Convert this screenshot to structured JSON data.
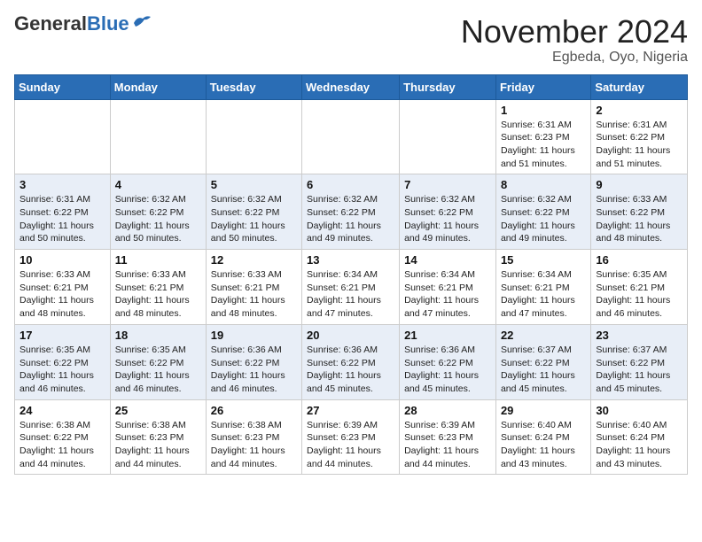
{
  "header": {
    "logo_general": "General",
    "logo_blue": "Blue",
    "month_title": "November 2024",
    "location": "Egbeda, Oyo, Nigeria"
  },
  "weekdays": [
    "Sunday",
    "Monday",
    "Tuesday",
    "Wednesday",
    "Thursday",
    "Friday",
    "Saturday"
  ],
  "weeks": [
    [
      {
        "day": "",
        "info": ""
      },
      {
        "day": "",
        "info": ""
      },
      {
        "day": "",
        "info": ""
      },
      {
        "day": "",
        "info": ""
      },
      {
        "day": "",
        "info": ""
      },
      {
        "day": "1",
        "info": "Sunrise: 6:31 AM\nSunset: 6:23 PM\nDaylight: 11 hours\nand 51 minutes."
      },
      {
        "day": "2",
        "info": "Sunrise: 6:31 AM\nSunset: 6:22 PM\nDaylight: 11 hours\nand 51 minutes."
      }
    ],
    [
      {
        "day": "3",
        "info": "Sunrise: 6:31 AM\nSunset: 6:22 PM\nDaylight: 11 hours\nand 50 minutes."
      },
      {
        "day": "4",
        "info": "Sunrise: 6:32 AM\nSunset: 6:22 PM\nDaylight: 11 hours\nand 50 minutes."
      },
      {
        "day": "5",
        "info": "Sunrise: 6:32 AM\nSunset: 6:22 PM\nDaylight: 11 hours\nand 50 minutes."
      },
      {
        "day": "6",
        "info": "Sunrise: 6:32 AM\nSunset: 6:22 PM\nDaylight: 11 hours\nand 49 minutes."
      },
      {
        "day": "7",
        "info": "Sunrise: 6:32 AM\nSunset: 6:22 PM\nDaylight: 11 hours\nand 49 minutes."
      },
      {
        "day": "8",
        "info": "Sunrise: 6:32 AM\nSunset: 6:22 PM\nDaylight: 11 hours\nand 49 minutes."
      },
      {
        "day": "9",
        "info": "Sunrise: 6:33 AM\nSunset: 6:22 PM\nDaylight: 11 hours\nand 48 minutes."
      }
    ],
    [
      {
        "day": "10",
        "info": "Sunrise: 6:33 AM\nSunset: 6:21 PM\nDaylight: 11 hours\nand 48 minutes."
      },
      {
        "day": "11",
        "info": "Sunrise: 6:33 AM\nSunset: 6:21 PM\nDaylight: 11 hours\nand 48 minutes."
      },
      {
        "day": "12",
        "info": "Sunrise: 6:33 AM\nSunset: 6:21 PM\nDaylight: 11 hours\nand 48 minutes."
      },
      {
        "day": "13",
        "info": "Sunrise: 6:34 AM\nSunset: 6:21 PM\nDaylight: 11 hours\nand 47 minutes."
      },
      {
        "day": "14",
        "info": "Sunrise: 6:34 AM\nSunset: 6:21 PM\nDaylight: 11 hours\nand 47 minutes."
      },
      {
        "day": "15",
        "info": "Sunrise: 6:34 AM\nSunset: 6:21 PM\nDaylight: 11 hours\nand 47 minutes."
      },
      {
        "day": "16",
        "info": "Sunrise: 6:35 AM\nSunset: 6:21 PM\nDaylight: 11 hours\nand 46 minutes."
      }
    ],
    [
      {
        "day": "17",
        "info": "Sunrise: 6:35 AM\nSunset: 6:22 PM\nDaylight: 11 hours\nand 46 minutes."
      },
      {
        "day": "18",
        "info": "Sunrise: 6:35 AM\nSunset: 6:22 PM\nDaylight: 11 hours\nand 46 minutes."
      },
      {
        "day": "19",
        "info": "Sunrise: 6:36 AM\nSunset: 6:22 PM\nDaylight: 11 hours\nand 46 minutes."
      },
      {
        "day": "20",
        "info": "Sunrise: 6:36 AM\nSunset: 6:22 PM\nDaylight: 11 hours\nand 45 minutes."
      },
      {
        "day": "21",
        "info": "Sunrise: 6:36 AM\nSunset: 6:22 PM\nDaylight: 11 hours\nand 45 minutes."
      },
      {
        "day": "22",
        "info": "Sunrise: 6:37 AM\nSunset: 6:22 PM\nDaylight: 11 hours\nand 45 minutes."
      },
      {
        "day": "23",
        "info": "Sunrise: 6:37 AM\nSunset: 6:22 PM\nDaylight: 11 hours\nand 45 minutes."
      }
    ],
    [
      {
        "day": "24",
        "info": "Sunrise: 6:38 AM\nSunset: 6:22 PM\nDaylight: 11 hours\nand 44 minutes."
      },
      {
        "day": "25",
        "info": "Sunrise: 6:38 AM\nSunset: 6:23 PM\nDaylight: 11 hours\nand 44 minutes."
      },
      {
        "day": "26",
        "info": "Sunrise: 6:38 AM\nSunset: 6:23 PM\nDaylight: 11 hours\nand 44 minutes."
      },
      {
        "day": "27",
        "info": "Sunrise: 6:39 AM\nSunset: 6:23 PM\nDaylight: 11 hours\nand 44 minutes."
      },
      {
        "day": "28",
        "info": "Sunrise: 6:39 AM\nSunset: 6:23 PM\nDaylight: 11 hours\nand 44 minutes."
      },
      {
        "day": "29",
        "info": "Sunrise: 6:40 AM\nSunset: 6:24 PM\nDaylight: 11 hours\nand 43 minutes."
      },
      {
        "day": "30",
        "info": "Sunrise: 6:40 AM\nSunset: 6:24 PM\nDaylight: 11 hours\nand 43 minutes."
      }
    ]
  ]
}
